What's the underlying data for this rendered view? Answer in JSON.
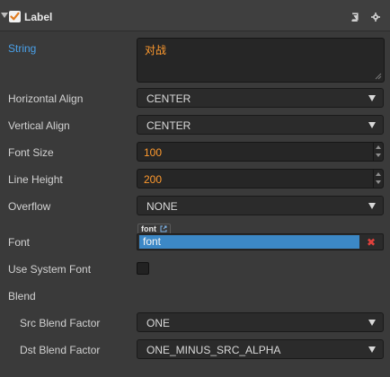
{
  "component": {
    "title": "Label",
    "enabled": true,
    "icons": [
      "book-icon",
      "gear-icon"
    ]
  },
  "properties": {
    "string": {
      "label": "String",
      "value": "对战"
    },
    "horizontal_align": {
      "label": "Horizontal Align",
      "value": "CENTER"
    },
    "vertical_align": {
      "label": "Vertical Align",
      "value": "CENTER"
    },
    "font_size": {
      "label": "Font Size",
      "value": "100"
    },
    "line_height": {
      "label": "Line Height",
      "value": "200"
    },
    "overflow": {
      "label": "Overflow",
      "value": "NONE"
    },
    "font": {
      "label": "Font",
      "asset_type": "font",
      "value": "font"
    },
    "use_system_font": {
      "label": "Use System Font",
      "checked": false
    },
    "blend": {
      "label": "Blend"
    },
    "src_blend_factor": {
      "label": "Src Blend Factor",
      "value": "ONE"
    },
    "dst_blend_factor": {
      "label": "Dst Blend Factor",
      "value": "ONE_MINUS_SRC_ALPHA"
    }
  },
  "colors": {
    "panel_bg": "#3a3a3a",
    "accent_label": "#4aa0e8",
    "value_orange": "#ff9a2e",
    "asset_selected": "#3c88c6",
    "clear_red": "#e0413c"
  }
}
